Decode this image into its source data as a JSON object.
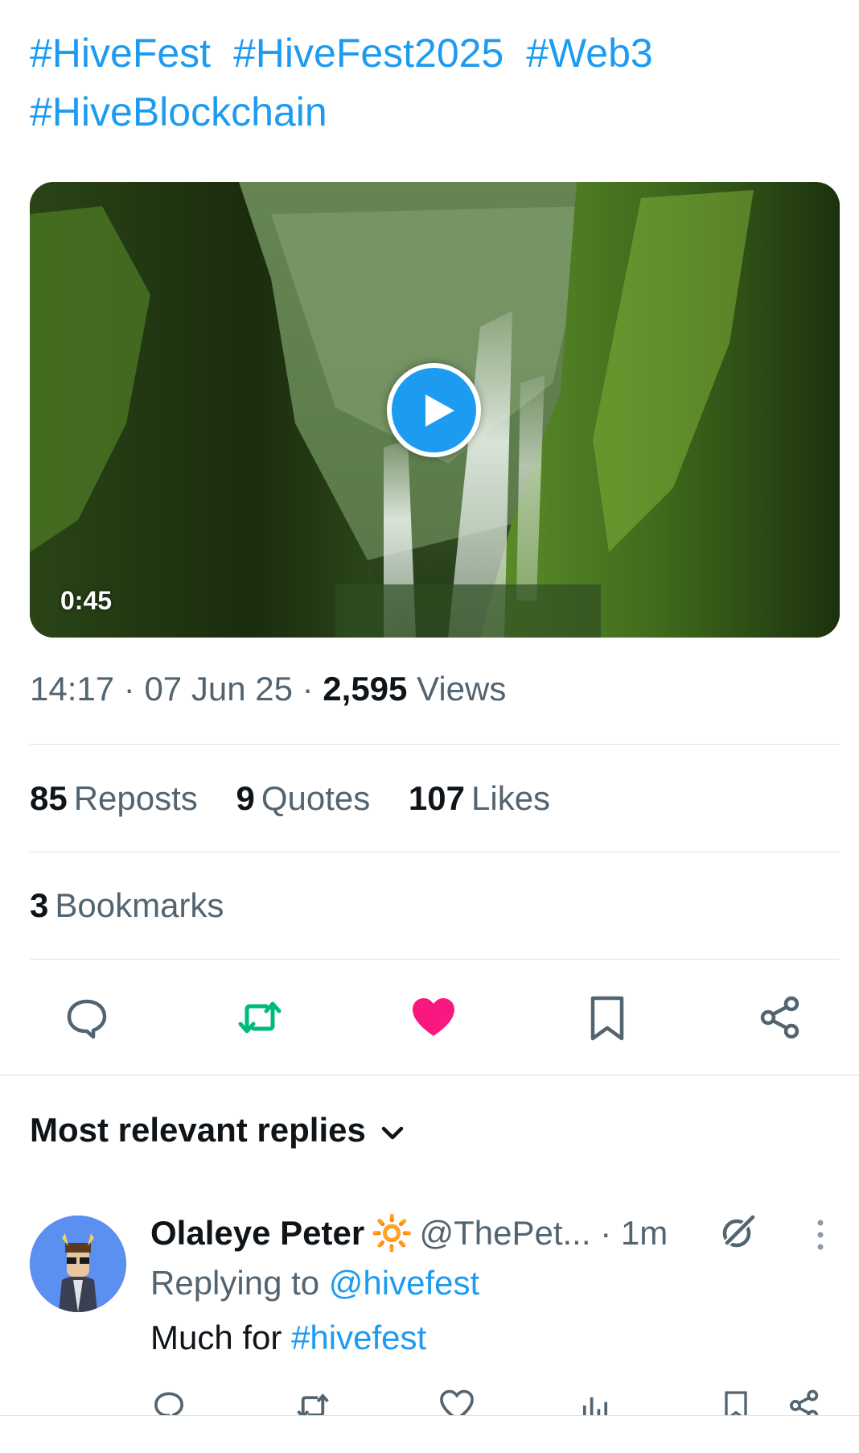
{
  "post": {
    "hashtags": [
      "#HiveFest",
      "#HiveFest2025",
      "#Web3",
      "#HiveBlockchain"
    ],
    "video": {
      "duration": "0:45",
      "play_icon": "play-icon"
    },
    "time": "14:17",
    "date": "07 Jun 25",
    "separator": "·",
    "views_count": "2,595",
    "views_label": "Views",
    "reposts_count": "85",
    "reposts_label": "Reposts",
    "quotes_count": "9",
    "quotes_label": "Quotes",
    "likes_count": "107",
    "likes_label": "Likes",
    "bookmarks_count": "3",
    "bookmarks_label": "Bookmarks"
  },
  "actions": {
    "reply_icon": "reply-icon",
    "repost_icon": "repost-icon",
    "like_icon": "heart-filled-icon",
    "bookmark_icon": "bookmark-icon",
    "share_icon": "share-icon",
    "colors": {
      "repost": "#00ba7c",
      "like": "#f91880",
      "default": "#536471"
    }
  },
  "replies": {
    "sort_label": "Most relevant replies",
    "items": [
      {
        "name": "Olaleye Peter",
        "badge": "🔆",
        "handle": "@ThePet...",
        "time": "1m",
        "replying_prefix": "Replying to",
        "replying_to": "@hivefest",
        "text_prefix": "Much for",
        "text_tag": "#hivefest"
      }
    ]
  },
  "colors": {
    "accent": "#1d9bf0",
    "text": "#0f1419",
    "secondary": "#536471"
  }
}
